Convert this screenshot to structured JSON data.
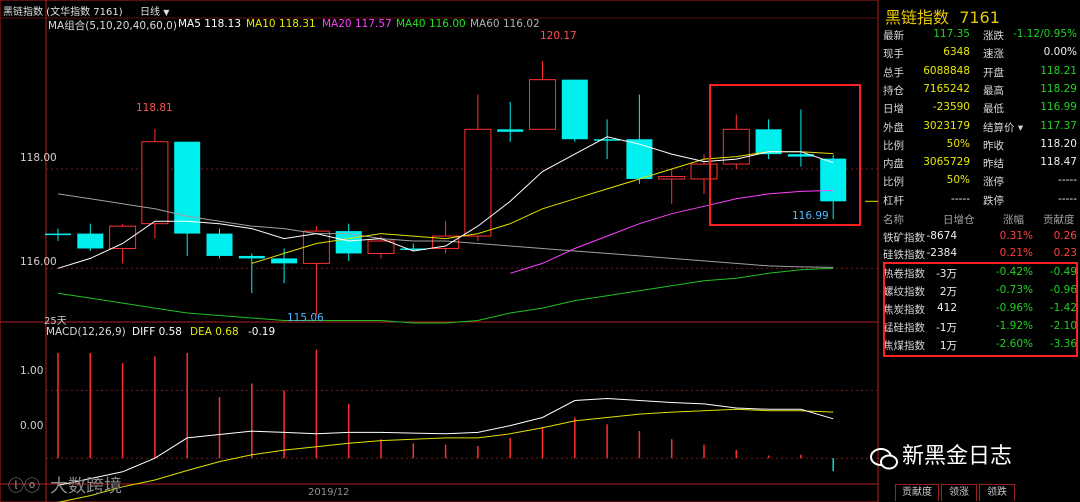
{
  "title_bar": {
    "title": "黑链指数 (文华指数 7161)",
    "period": "日线",
    "arrow": "▼"
  },
  "ma_legend": [
    {
      "label": "MA组合(5,10,20,40,60,0)",
      "color": "#d8d8d8"
    },
    {
      "label": "MA5 118.13",
      "color": "#ffffff"
    },
    {
      "label": "MA10 118.31",
      "color": "#e8e800"
    },
    {
      "label": "MA20 117.57",
      "color": "#ff40ff"
    },
    {
      "label": "MA40 116.00",
      "color": "#20e020"
    },
    {
      "label": "MA60 116.02",
      "color": "#b0b0b0"
    }
  ],
  "macd_legend": [
    {
      "label": "MACD(12,26,9)",
      "color": "#d8d8d8"
    },
    {
      "label": "DIFF 0.58",
      "color": "#ffffff"
    },
    {
      "label": "DEA 0.68",
      "color": "#e8e800"
    },
    {
      "label": "-0.19",
      "color": "#ffffff"
    }
  ],
  "price_axis": [
    "118.00",
    "116.00"
  ],
  "macd_axis": [
    "1.00",
    "0.00"
  ],
  "annotations": {
    "high_left": "118.81",
    "high_mid": "120.17",
    "low_mark": "115.06",
    "last_low": "116.99",
    "days": "25天",
    "date": "2019/12"
  },
  "chart_data": {
    "type": "candlestick",
    "ylim": [
      115.0,
      120.8
    ],
    "candles": [
      {
        "o": 116.7,
        "h": 116.8,
        "l": 116.55,
        "c": 116.7,
        "color": "cyan"
      },
      {
        "o": 116.7,
        "h": 116.9,
        "l": 116.35,
        "c": 116.4,
        "color": "cyan"
      },
      {
        "o": 116.4,
        "h": 116.9,
        "l": 116.1,
        "c": 116.85,
        "color": "red"
      },
      {
        "o": 116.9,
        "h": 118.81,
        "l": 116.6,
        "c": 118.55,
        "color": "red"
      },
      {
        "o": 118.55,
        "h": 118.55,
        "l": 116.25,
        "c": 116.7,
        "color": "cyan"
      },
      {
        "o": 116.7,
        "h": 116.8,
        "l": 116.2,
        "c": 116.25,
        "color": "cyan"
      },
      {
        "o": 116.25,
        "h": 116.3,
        "l": 115.5,
        "c": 116.2,
        "color": "cyan"
      },
      {
        "o": 116.2,
        "h": 116.4,
        "l": 115.7,
        "c": 116.1,
        "color": "cyan"
      },
      {
        "o": 116.1,
        "h": 116.85,
        "l": 115.06,
        "c": 116.75,
        "color": "red"
      },
      {
        "o": 116.75,
        "h": 116.9,
        "l": 116.15,
        "c": 116.3,
        "color": "cyan"
      },
      {
        "o": 116.3,
        "h": 116.65,
        "l": 116.2,
        "c": 116.55,
        "color": "red"
      },
      {
        "o": 116.4,
        "h": 116.5,
        "l": 116.35,
        "c": 116.4,
        "color": "cyan"
      },
      {
        "o": 116.4,
        "h": 116.95,
        "l": 116.3,
        "c": 116.65,
        "color": "red"
      },
      {
        "o": 116.65,
        "h": 119.5,
        "l": 116.55,
        "c": 118.8,
        "color": "red"
      },
      {
        "o": 118.8,
        "h": 119.35,
        "l": 118.55,
        "c": 118.75,
        "color": "cyan"
      },
      {
        "o": 118.8,
        "h": 120.17,
        "l": 118.8,
        "c": 119.8,
        "color": "red"
      },
      {
        "o": 119.8,
        "h": 119.8,
        "l": 118.55,
        "c": 118.6,
        "color": "cyan"
      },
      {
        "o": 118.6,
        "h": 119.0,
        "l": 118.2,
        "c": 118.6,
        "color": "cyan"
      },
      {
        "o": 118.6,
        "h": 119.5,
        "l": 117.7,
        "c": 117.8,
        "color": "cyan"
      },
      {
        "o": 117.8,
        "h": 118.0,
        "l": 117.3,
        "c": 117.85,
        "color": "red"
      },
      {
        "o": 117.8,
        "h": 118.3,
        "l": 117.5,
        "c": 118.1,
        "color": "red"
      },
      {
        "o": 118.1,
        "h": 119.1,
        "l": 118.0,
        "c": 118.8,
        "color": "red"
      },
      {
        "o": 118.8,
        "h": 119.0,
        "l": 118.2,
        "c": 118.3,
        "color": "cyan"
      },
      {
        "o": 118.3,
        "h": 119.2,
        "l": 118.05,
        "c": 118.25,
        "color": "cyan"
      },
      {
        "o": 118.21,
        "h": 118.29,
        "l": 116.99,
        "c": 117.35,
        "color": "cyan"
      }
    ],
    "ma5": [
      116.0,
      116.2,
      116.5,
      116.95,
      116.95,
      116.9,
      116.8,
      116.6,
      116.7,
      116.55,
      116.6,
      116.35,
      116.45,
      116.85,
      117.35,
      117.95,
      118.3,
      118.65,
      118.5,
      118.3,
      118.15,
      118.2,
      118.35,
      118.35,
      118.13
    ],
    "ma10": [
      null,
      null,
      null,
      null,
      null,
      null,
      116.1,
      116.3,
      116.5,
      116.6,
      116.7,
      116.65,
      116.6,
      116.7,
      116.9,
      117.2,
      117.4,
      117.6,
      117.8,
      118.0,
      118.2,
      118.25,
      118.35,
      118.35,
      118.31
    ],
    "ma20": [
      null,
      null,
      null,
      null,
      null,
      null,
      null,
      null,
      null,
      null,
      null,
      null,
      null,
      null,
      115.9,
      116.1,
      116.4,
      116.65,
      116.9,
      117.1,
      117.25,
      117.4,
      117.5,
      117.55,
      117.57
    ],
    "ma40": [
      115.5,
      115.4,
      115.3,
      115.2,
      115.1,
      115.05,
      115.0,
      114.95,
      114.95,
      114.95,
      114.95,
      114.9,
      114.9,
      114.95,
      115.1,
      115.2,
      115.35,
      115.45,
      115.55,
      115.65,
      115.75,
      115.8,
      115.9,
      115.97,
      116.0
    ],
    "ma60": [
      117.5,
      117.4,
      117.3,
      117.2,
      117.05,
      116.95,
      116.85,
      116.8,
      116.7,
      116.7,
      116.6,
      116.55,
      116.55,
      116.5,
      116.45,
      116.4,
      116.35,
      116.3,
      116.25,
      116.2,
      116.15,
      116.1,
      116.05,
      116.03,
      116.02
    ],
    "macd_ylim": [
      -0.35,
      1.8
    ],
    "diff": [
      -0.4,
      -0.3,
      -0.2,
      0.0,
      0.3,
      0.35,
      0.4,
      0.38,
      0.36,
      0.38,
      0.38,
      0.37,
      0.36,
      0.38,
      0.48,
      0.6,
      0.85,
      0.88,
      0.85,
      0.82,
      0.8,
      0.74,
      0.72,
      0.72,
      0.58
    ],
    "dea": [
      -0.65,
      -0.55,
      -0.42,
      -0.32,
      -0.18,
      -0.05,
      0.05,
      0.12,
      0.17,
      0.22,
      0.26,
      0.28,
      0.3,
      0.3,
      0.36,
      0.45,
      0.55,
      0.6,
      0.65,
      0.68,
      0.7,
      0.72,
      0.7,
      0.7,
      0.68
    ],
    "hist": [
      1.55,
      1.55,
      1.4,
      1.5,
      1.55,
      0.9,
      1.1,
      1.0,
      1.6,
      0.8,
      0.28,
      0.22,
      0.2,
      0.18,
      0.3,
      0.46,
      0.6,
      0.5,
      0.4,
      0.28,
      0.2,
      0.12,
      0.04,
      0.05,
      -0.19
    ]
  },
  "panel": {
    "title": "黑链指数",
    "code": "7161",
    "quote_rows": [
      {
        "l1": "最新",
        "v1": "117.35",
        "c1": "green",
        "l2": "涨跌",
        "v2": "-1.12/0.95%",
        "c2": "green"
      },
      {
        "l1": "现手",
        "v1": "6348",
        "c1": "yellow",
        "l2": "速涨",
        "v2": "0.00%",
        "c2": "white"
      },
      {
        "l1": "总手",
        "v1": "6088848",
        "c1": "yellow",
        "l2": "开盘",
        "v2": "118.21",
        "c2": "green"
      },
      {
        "l1": "持仓",
        "v1": "7165242",
        "c1": "yellow",
        "l2": "最高",
        "v2": "118.29",
        "c2": "green"
      },
      {
        "l1": "日增",
        "v1": "-23590",
        "c1": "yellow",
        "l2": "最低",
        "v2": "116.99",
        "c2": "green"
      },
      {
        "l1": "外盘",
        "v1": "3023179",
        "c1": "yellow",
        "l2": "结算价 ▾",
        "v2": "117.37",
        "c2": "green"
      },
      {
        "l1": "比例",
        "v1": "50%",
        "c1": "yellow",
        "l2": "昨收",
        "v2": "118.20",
        "c2": "white"
      },
      {
        "l1": "内盘",
        "v1": "3065729",
        "c1": "yellow",
        "l2": "昨结",
        "v2": "118.47",
        "c2": "white"
      },
      {
        "l1": "比例",
        "v1": "50%",
        "c1": "yellow",
        "l2": "涨停",
        "v2": "-----",
        "c2": "white"
      },
      {
        "l1": "杠杆",
        "v1": "-----",
        "c1": "white",
        "l2": "跌停",
        "v2": "-----",
        "c2": "white"
      }
    ],
    "table_headers": [
      "名称",
      "日增仓",
      "涨幅",
      "贡献度"
    ],
    "components": [
      {
        "name": "铁矿指数",
        "inc": "-8674",
        "chg": "0.31%",
        "contrib": "0.26",
        "color": "red"
      },
      {
        "name": "硅铁指数",
        "inc": "-2384",
        "chg": "0.21%",
        "contrib": "0.23",
        "color": "red"
      },
      {
        "name": "热卷指数",
        "inc": "-3万",
        "chg": "-0.42%",
        "contrib": "-0.49",
        "color": "green"
      },
      {
        "name": "螺纹指数",
        "inc": "2万",
        "chg": "-0.73%",
        "contrib": "-0.96",
        "color": "green"
      },
      {
        "name": "焦炭指数",
        "inc": "412",
        "chg": "-0.96%",
        "contrib": "-1.42",
        "color": "green"
      },
      {
        "name": "锰硅指数",
        "inc": "-1万",
        "chg": "-1.92%",
        "contrib": "-2.10",
        "color": "green"
      },
      {
        "name": "焦煤指数",
        "inc": "1万",
        "chg": "-2.60%",
        "contrib": "-3.36",
        "color": "green"
      }
    ],
    "tabs": [
      "贡献度",
      "领涨",
      "领跌"
    ]
  },
  "watermarks": {
    "wechat": "新黑金日志",
    "brand": "大数跨境"
  }
}
